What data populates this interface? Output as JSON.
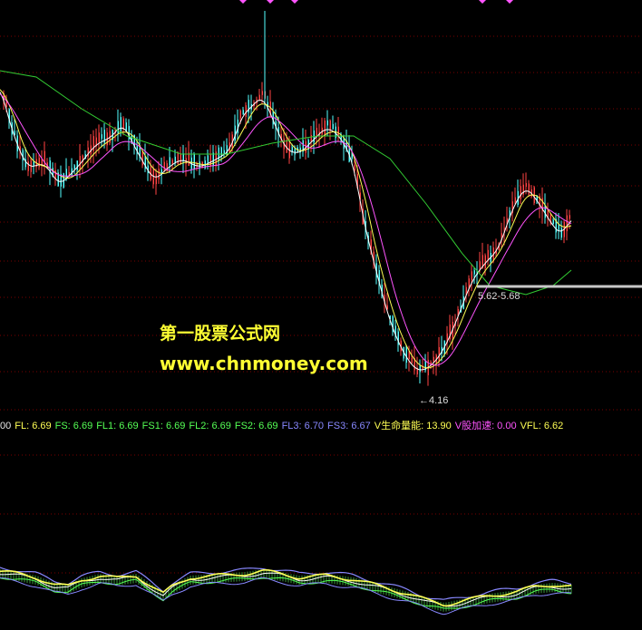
{
  "watermark": {
    "site_name": "第一股票公式网",
    "site_url": "www.chnmoney.com"
  },
  "annotations": {
    "price_range_label": "5.62-5.68",
    "low_marker_label": "←4.16"
  },
  "legend": [
    {
      "label": "00",
      "value": "",
      "color": "#e6e6e6"
    },
    {
      "label": "FL:",
      "value": "6.69",
      "color": "#ffff55"
    },
    {
      "label": "FS:",
      "value": "6.69",
      "color": "#55ff55"
    },
    {
      "label": "FL1:",
      "value": "6.69",
      "color": "#55ff55"
    },
    {
      "label": "FS1:",
      "value": "6.69",
      "color": "#55ff55"
    },
    {
      "label": "FL2:",
      "value": "6.69",
      "color": "#55ff55"
    },
    {
      "label": "FS2:",
      "value": "6.69",
      "color": "#55ff55"
    },
    {
      "label": "FL3:",
      "value": "6.70",
      "color": "#8888ff"
    },
    {
      "label": "FS3:",
      "value": "6.67",
      "color": "#8888ff"
    },
    {
      "label": "V生命量能:",
      "value": "13.90",
      "color": "#ffff55"
    },
    {
      "label": "V股加速:",
      "value": "0.00",
      "color": "#ff55ff"
    },
    {
      "label": "VFL:",
      "value": "6.62",
      "color": "#ffff55"
    }
  ],
  "colors": {
    "background": "#000000",
    "grid": "#7a0000",
    "candle_up": "#ff4444",
    "candle_down": "#55ffff",
    "ma_fast": "#ffffff",
    "ma_mid": "#ffff55",
    "ma_slow": "#ff55ff",
    "ma_long": "#33cc33",
    "resistance": "#c8c8c8"
  }
}
